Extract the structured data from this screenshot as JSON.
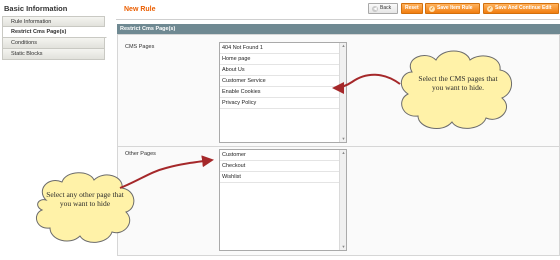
{
  "sidebar": {
    "title": "Basic Information",
    "tabs": [
      {
        "label": "Rule Information"
      },
      {
        "label": "Restrict Cms Page(s)"
      },
      {
        "label": "Conditions"
      },
      {
        "label": "Static Blocks"
      }
    ]
  },
  "header": {
    "title": "New Rule",
    "buttons": {
      "back": "Back",
      "reset": "Reset",
      "save": "Save Item Rule",
      "save_continue": "Save And Continue Edit"
    }
  },
  "fieldset": {
    "title": "Restrict Cms Page(s)",
    "cms_pages": {
      "label": "CMS Pages",
      "options": [
        "404 Not Found 1",
        "Home page",
        "About Us",
        "Customer Service",
        "Enable Cookies",
        "Privacy Policy"
      ]
    },
    "other_pages": {
      "label": "Other Pages",
      "options": [
        "Customer",
        "Checkout",
        "Wishlist"
      ]
    }
  },
  "callouts": {
    "right": "Select the CMS pages that you want to hide.",
    "left": "Select any other page that you want to hide"
  },
  "colors": {
    "accent_orange": "#eb5e00",
    "fieldset_header": "#6f8992",
    "callout_fill": "#fff2a8",
    "arrow_red": "#a5282a"
  }
}
